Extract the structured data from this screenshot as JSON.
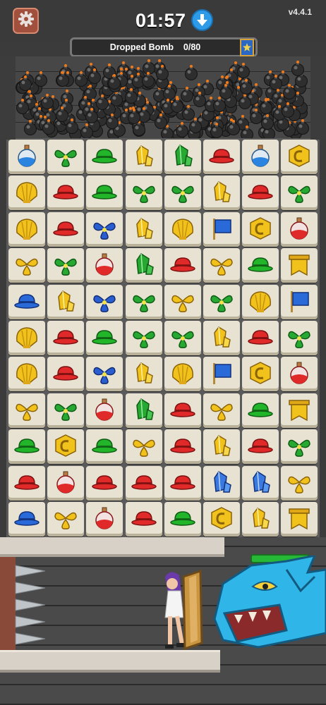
{
  "header": {
    "timer": "01:57",
    "version": "v4.4.1",
    "settings_icon": "gear-icon",
    "timer_icon": "down-arrow-icon"
  },
  "progress": {
    "label": "Dropped Bomb",
    "count": "0/80",
    "dropped": 0,
    "total": 80,
    "badge_icon": "star-banner-icon"
  },
  "board": {
    "rows": [
      [
        "potion-blue",
        "leaf",
        "hat-green",
        "crystal-yellow",
        "crystal-green",
        "hat-red",
        "potion-blue",
        "coin"
      ],
      [
        "shell",
        "hat-red",
        "hat-green",
        "leaf",
        "leaf",
        "crystal-yellow",
        "hat-red",
        "leaf"
      ],
      [
        "shell",
        "hat-red",
        "leaf-blue",
        "crystal-yellow",
        "shell",
        "flag",
        "coin",
        "potion-red"
      ],
      [
        "leaf-yellow",
        "leaf",
        "potion-red",
        "crystal-green",
        "hat-red",
        "leaf-yellow",
        "hat-green",
        "banner"
      ],
      [
        "hat-blue",
        "crystal-yellow",
        "leaf-blue",
        "leaf",
        "leaf-yellow",
        "leaf",
        "shell",
        "flag"
      ],
      [
        "shell",
        "hat-red",
        "hat-green",
        "leaf",
        "leaf",
        "crystal-yellow",
        "hat-red",
        "leaf"
      ],
      [
        "shell",
        "hat-red",
        "leaf-blue",
        "crystal-yellow",
        "shell",
        "flag",
        "coin",
        "potion-red"
      ],
      [
        "leaf-yellow",
        "leaf",
        "potion-red",
        "crystal-green",
        "hat-red",
        "leaf-yellow",
        "hat-green",
        "banner"
      ],
      [
        "hat-green",
        "coin",
        "hat-green",
        "leaf-yellow",
        "hat-red",
        "crystal-yellow",
        "hat-red",
        "leaf"
      ],
      [
        "hat-red",
        "potion-red",
        "hat-red",
        "hat-red",
        "hat-red",
        "crystal-blue",
        "crystal-blue",
        "leaf-yellow"
      ],
      [
        "hat-blue",
        "leaf-yellow",
        "potion-red",
        "hat-red",
        "hat-green",
        "coin",
        "crystal-yellow",
        "banner"
      ]
    ]
  },
  "scene": {
    "hero": "heroine-with-shield",
    "enemy": "blue-dragon",
    "hazard": "spike-wall",
    "enemy_hp": 1.0
  },
  "colors": {
    "tile_face": "#e7e2d2",
    "hat_red": "#e02a2a",
    "hat_green": "#22b52a",
    "hat_blue": "#2a6ad8",
    "yellow": "#f2c21c",
    "leaf_green": "#27a832",
    "bomb": "#2e2e2e"
  }
}
